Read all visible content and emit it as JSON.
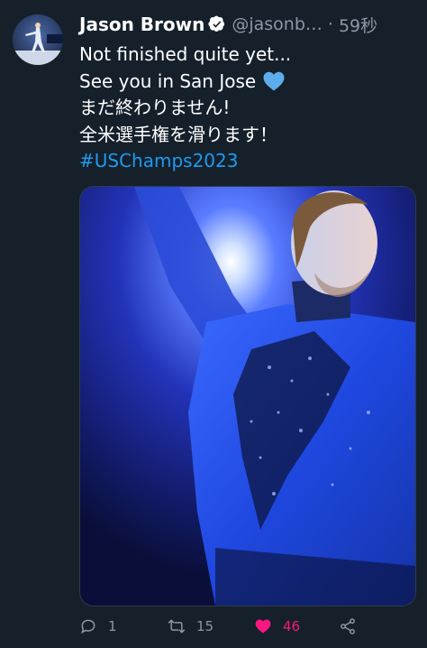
{
  "tweet": {
    "display_name": "Jason Brown",
    "handle": "@jasonb…",
    "separator": "·",
    "time": "59秒",
    "lines": [
      "Not finished quite yet...",
      "See you in San Jose",
      "まだ終わりません!",
      "全米選手権を滑ります！"
    ],
    "hashtag": "#USChamps2023"
  },
  "actions": {
    "reply_count": "1",
    "retweet_count": "15",
    "like_count": "46"
  },
  "colors": {
    "background": "#15202b",
    "hashtag": "#1d9bf0",
    "like": "#f91880",
    "verified": "#ffffff",
    "muted": "#8b98a5",
    "heart_emoji": "#5dadec"
  },
  "icons": {
    "verified": "verified-badge-icon",
    "emoji": "blue-heart-icon",
    "reply": "reply-icon",
    "retweet": "retweet-icon",
    "like": "heart-icon",
    "share": "share-icon"
  }
}
